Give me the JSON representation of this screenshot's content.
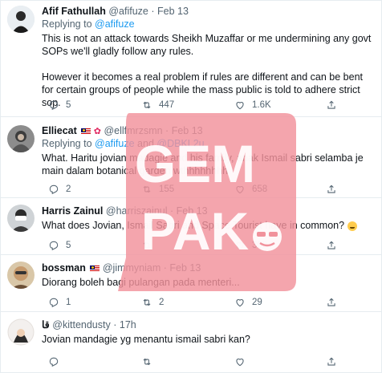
{
  "tweets": [
    {
      "name": "Afif Fathullah",
      "handle": "@afifuze",
      "dot": "·",
      "time": "Feb 13",
      "reply_prefix": "Replying to",
      "reply_to": "@afifuze",
      "reply_conj": "",
      "reply_to_2": "",
      "text_1": "This is not an attack towards Sheikh Muzaffar or me undermining any govt SOPs we'll gladly follow any rules.",
      "text_2": "However it becomes a real problem if rules are different and can be bent for certain groups of people while the mass public is told to adhere strict sop.",
      "replies": "5",
      "retweets": "447",
      "likes": "1.6K"
    },
    {
      "name": "Elliecat",
      "handle": "@ellfmrzsmn",
      "dot": "·",
      "time": "Feb 13",
      "reply_prefix": "Replying to",
      "reply_to": "@afifuze",
      "reply_conj": "and",
      "reply_to_2": "@DBKL2u",
      "text_1": "What. Haritu jovian madagie and his family, anak Ismail sabri selamba je main dalam botanical garden wthhhhhhhh",
      "replies": "2",
      "retweets": "155",
      "likes": "658"
    },
    {
      "name": "Harris Zainul",
      "handle": "@harriszainul",
      "dot": "·",
      "time": "Feb 13",
      "text_1": "What does Jovian, Ismail Sabri and Space Tourist have in common?",
      "replies": "5",
      "retweets": "",
      "likes": "309"
    },
    {
      "name": "bossman",
      "handle": "@jimmyniam",
      "dot": "·",
      "time": "Feb 13",
      "text_1": "Diorang boleh bagi pulangan pada menteri...",
      "replies": "1",
      "retweets": "2",
      "likes": "29"
    },
    {
      "name": "قا",
      "handle": "@kittendusty",
      "dot": "·",
      "time": "17h",
      "text_1": "Jovian mandagie yg menantu ismail sabri kan?",
      "replies": "",
      "retweets": "",
      "likes": ""
    }
  ],
  "watermark": {
    "line1": "GEM",
    "line2": "PAK",
    "color": "#f1919b"
  },
  "icons": [
    "reply-icon",
    "retweet-icon",
    "like-icon",
    "share-icon",
    "flag-malaysia-icon",
    "flower-icon",
    "wink-emoji-icon"
  ],
  "colors": {
    "link": "#1d9bf0",
    "secondary": "#536471",
    "text": "#0f1419",
    "divider": "#e6ecf0"
  }
}
